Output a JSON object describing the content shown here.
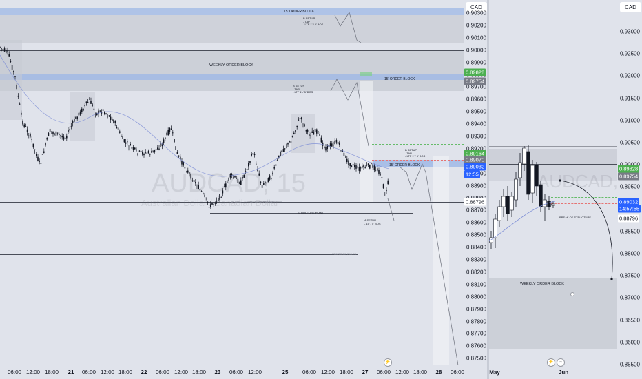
{
  "left_chart": {
    "currency": "CAD",
    "watermark_symbol": "AUDCAD, 15",
    "watermark_name": "Australian Dollar / Canadian Dollar",
    "price_ticks": [
      "0.90300",
      "0.90200",
      "0.90100",
      "0.90000",
      "0.89900",
      "0.89800",
      "0.89700",
      "0.89600",
      "0.89500",
      "0.89400",
      "0.89300",
      "0.89200",
      "0.89100",
      "0.89000",
      "0.88900",
      "0.88800",
      "0.88700",
      "0.88600",
      "0.88500",
      "0.88400",
      "0.88300",
      "0.88200",
      "0.88100",
      "0.88000",
      "0.87900",
      "0.87800",
      "0.87700",
      "0.87600",
      "0.87500"
    ],
    "time_ticks": [
      "06:00",
      "12:00",
      "18:00",
      "21",
      "06:00",
      "12:00",
      "18:00",
      "22",
      "06:00",
      "12:00",
      "18:00",
      "23",
      "06:00",
      "12:00",
      "25",
      "06:00",
      "12:00",
      "18:00",
      "27",
      "06:00",
      "12:00",
      "18:00",
      "28",
      "06:00"
    ],
    "price_tags": {
      "green_top": "0.89828",
      "dark_top": "0.89754",
      "green_mid": "0.89164",
      "dark_mid": "0.89070",
      "blue_price": "0.89032",
      "blue_countdown": "12:55",
      "plain": "0.88796"
    },
    "labels": {
      "ob15_top": "15' ORDER BLOCK",
      "weekly_ob": "WEEKLY ORDER BLOCK",
      "ob15_mid": "15' ORDER BLOCK",
      "ob15_low": "15' ORDER BLOCK",
      "b_setup_1": [
        "B SETUP",
        "- TAP",
        "- LTF 1' / 5' BOS"
      ],
      "b_setup_2": [
        "B SETUP",
        "- TAP",
        "- LTF 1' / 5' BOS"
      ],
      "b_setup_3": [
        "B SETUP",
        "- TAP",
        "- LTF 1' / 5' BOS"
      ],
      "a_setup": [
        "A SETUP",
        "- 15' / 5' BOS"
      ],
      "structure_point": "STRUCTURE POINT",
      "bos_low": "4H BOS",
      "tto_right": "TTO TO BE FILLED",
      "tto_low": "TTO TO BE FILLED"
    }
  },
  "right_chart": {
    "currency": "CAD",
    "watermark_symbol": "AUDCAD, 1D",
    "price_ticks": [
      "0.93000",
      "0.92500",
      "0.92000",
      "0.91500",
      "0.91000",
      "0.90500",
      "0.90000",
      "0.89500",
      "0.89000",
      "0.88500",
      "0.88000",
      "0.87500",
      "0.87000",
      "0.86500",
      "0.86000",
      "0.85500"
    ],
    "time_ticks": [
      "May",
      "Jun"
    ],
    "price_tags": {
      "green": "0.89828",
      "dark": "0.89754",
      "blue_price": "0.89032",
      "blue_countdown": "14:57:55",
      "plain": "0.88796"
    },
    "labels": {
      "weekly_ob": "WEEKLY ORDER BLOCK",
      "break_structure": "BREAK OF STRUCTURE"
    }
  },
  "colors": {
    "background": "#e0e3eb",
    "zone_gray": "#c7cad3",
    "zone_blue": "#9fb8e6",
    "green_tag": "#4caf50",
    "blue_tag": "#2962ff",
    "candle": "#131722"
  }
}
